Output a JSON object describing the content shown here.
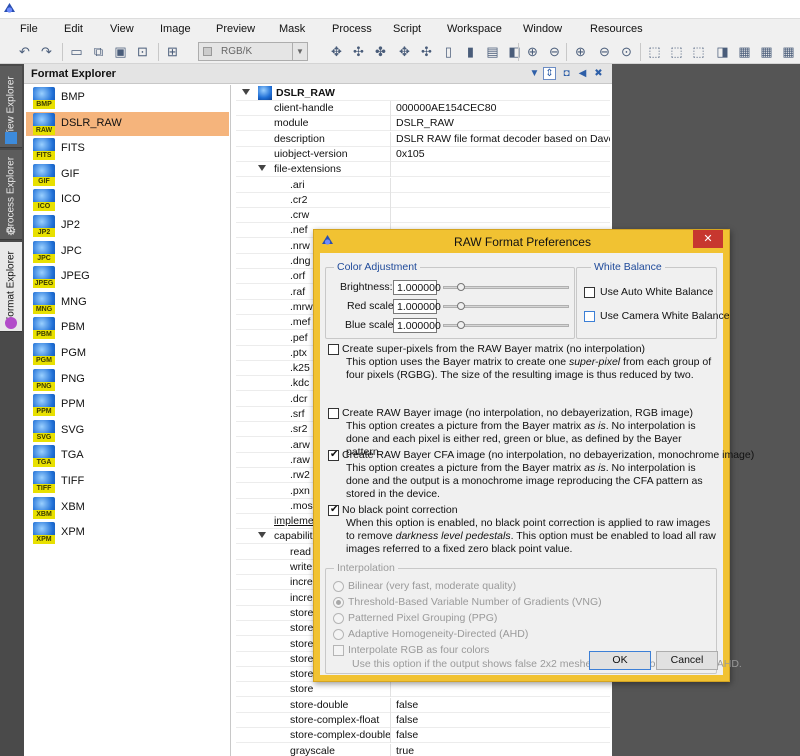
{
  "menu": [
    "File",
    "Edit",
    "View",
    "Image",
    "Preview",
    "Mask",
    "Process",
    "Script",
    "Workspace",
    "Window",
    "Resources"
  ],
  "toolbar": {
    "color_space": "RGB/K"
  },
  "vtabs": [
    "View Explorer",
    "Process Explorer",
    "Format Explorer"
  ],
  "panel": {
    "title": "Format Explorer"
  },
  "formats": [
    {
      "name": "BMP",
      "badge": "BMP"
    },
    {
      "name": "DSLR_RAW",
      "badge": "RAW"
    },
    {
      "name": "FITS",
      "badge": "FITS"
    },
    {
      "name": "GIF",
      "badge": "GIF"
    },
    {
      "name": "ICO",
      "badge": "ICO"
    },
    {
      "name": "JP2",
      "badge": "JP2"
    },
    {
      "name": "JPC",
      "badge": "JPC"
    },
    {
      "name": "JPEG",
      "badge": "JPEG"
    },
    {
      "name": "MNG",
      "badge": "MNG"
    },
    {
      "name": "PBM",
      "badge": "PBM"
    },
    {
      "name": "PGM",
      "badge": "PGM"
    },
    {
      "name": "PNG",
      "badge": "PNG"
    },
    {
      "name": "PPM",
      "badge": "PPM"
    },
    {
      "name": "SVG",
      "badge": "SVG"
    },
    {
      "name": "TGA",
      "badge": "TGA"
    },
    {
      "name": "TIFF",
      "badge": "TIFF"
    },
    {
      "name": "XBM",
      "badge": "XBM"
    },
    {
      "name": "XPM",
      "badge": "XPM"
    }
  ],
  "props": {
    "root": "DSLR_RAW",
    "rows": [
      {
        "name": "client-handle",
        "value": "000000AE154CEC80"
      },
      {
        "name": "module",
        "value": "DSLR_RAW"
      },
      {
        "name": "description",
        "value": "DSLR RAW file format decoder based on Dave Cof"
      },
      {
        "name": "uiobject-version",
        "value": "0x105"
      },
      {
        "name": "file-extensions",
        "value": ""
      },
      {
        "name": ".ari",
        "value": ""
      },
      {
        "name": ".cr2",
        "value": ""
      },
      {
        "name": ".crw",
        "value": ""
      },
      {
        "name": ".nef",
        "value": ""
      },
      {
        "name": ".nrw",
        "value": ""
      },
      {
        "name": ".dng",
        "value": ""
      },
      {
        "name": ".orf",
        "value": ""
      },
      {
        "name": ".raf",
        "value": ""
      },
      {
        "name": ".mrw",
        "value": ""
      },
      {
        "name": ".mef",
        "value": ""
      },
      {
        "name": ".pef",
        "value": ""
      },
      {
        "name": ".ptx",
        "value": ""
      },
      {
        "name": ".k25",
        "value": ""
      },
      {
        "name": ".kdc",
        "value": ""
      },
      {
        "name": ".dcr",
        "value": ""
      },
      {
        "name": ".srf",
        "value": ""
      },
      {
        "name": ".sr2",
        "value": ""
      },
      {
        "name": ".arw",
        "value": ""
      },
      {
        "name": ".raw",
        "value": ""
      },
      {
        "name": ".rw2",
        "value": ""
      },
      {
        "name": ".pxn",
        "value": ""
      },
      {
        "name": ".mos",
        "value": ""
      },
      {
        "name": "impleme",
        "value": ""
      },
      {
        "name": "capabiliti",
        "value": ""
      },
      {
        "name": "read",
        "value": ""
      },
      {
        "name": "write",
        "value": ""
      },
      {
        "name": "incre",
        "value": ""
      },
      {
        "name": "incre",
        "value": ""
      },
      {
        "name": "store",
        "value": ""
      },
      {
        "name": "store",
        "value": ""
      },
      {
        "name": "store",
        "value": ""
      },
      {
        "name": "store",
        "value": ""
      },
      {
        "name": "store",
        "value": ""
      },
      {
        "name": "store",
        "value": ""
      },
      {
        "name": "store-double",
        "value": "false"
      },
      {
        "name": "store-complex-float",
        "value": "false"
      },
      {
        "name": "store-complex-double",
        "value": "false"
      },
      {
        "name": "grayscale",
        "value": "true"
      },
      {
        "name": "rgb-color",
        "value": "true"
      }
    ]
  },
  "dialog": {
    "title": "RAW Format Preferences",
    "close": "✕",
    "color_adjustment": {
      "title": "Color Adjustment",
      "brightness_label": "Brightness:",
      "brightness": "1.000000",
      "red_label": "Red scale:",
      "red": "1.000000",
      "blue_label": "Blue scale:",
      "blue": "1.000000"
    },
    "white_balance": {
      "title": "White Balance",
      "auto_label": "Use Auto White Balance",
      "camera_label": "Use Camera White Balance"
    },
    "options": [
      {
        "label": "Create super-pixels from the RAW Bayer matrix (no interpolation)",
        "desc_1": "This option uses the Bayer matrix to create one ",
        "desc_em": "super-pixel",
        "desc_2": " from each group of four pixels (RGBG). The size of the resulting image is thus reduced by two."
      },
      {
        "label": "Create RAW Bayer image (no interpolation, no debayerization, RGB image)",
        "desc_1": "This option creates a picture from the Bayer matrix ",
        "desc_em": "as is",
        "desc_2": ". No interpolation is done and each pixel is either red, green or blue, as defined by the Bayer pattern."
      },
      {
        "label": "Create RAW Bayer CFA image (no interpolation, no debayerization, monochrome image)",
        "desc_1": "This option creates a picture from the Bayer matrix ",
        "desc_em": "as is",
        "desc_2": ". No interpolation is done and the output is a monochrome image reproducing the CFA pattern as stored in the device."
      },
      {
        "label": "No black point correction",
        "desc_1": "When this option is enabled, no black point correction is applied to raw images to remove ",
        "desc_em": "darkness level pedestals",
        "desc_2": ". This option must be enabled to load all raw images referred to a fixed zero black point value."
      }
    ],
    "interpolation": {
      "title": "Interpolation",
      "methods": [
        "Bilinear (very fast, moderate quality)",
        "Threshold-Based Variable Number of Gradients (VNG)",
        "Patterned Pixel Grouping (PPG)",
        "Adaptive Homogeneity-Directed (AHD)"
      ],
      "four_colors_label": "Interpolate RGB as four colors",
      "four_colors_desc": "Use this option if the output shows false 2x2 meshes with VNG, or mazes with AHD."
    },
    "ok": "OK",
    "cancel": "Cancel"
  }
}
